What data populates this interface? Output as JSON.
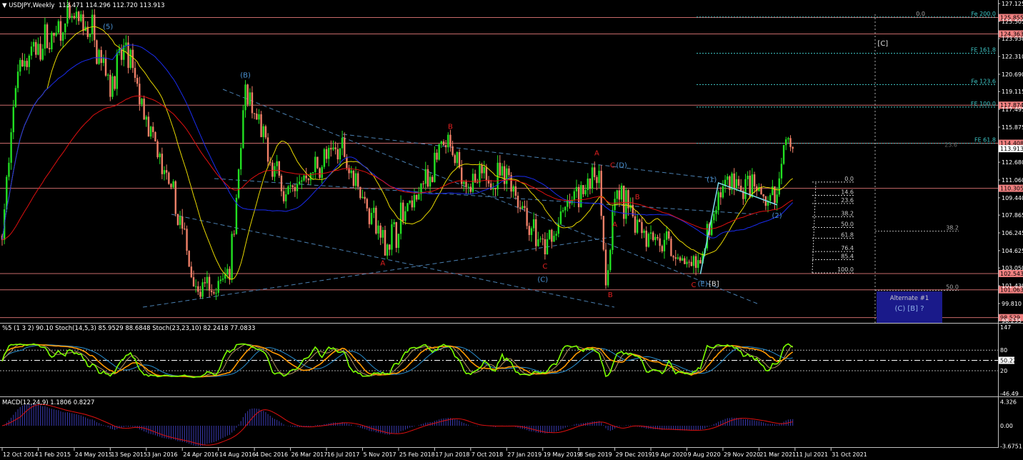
{
  "header": {
    "symbol_label": "USDJPY,Weekly",
    "ohlc": "113.471 114.296 112.720 113.913"
  },
  "stoch_panel": {
    "label": "%5 (1 3 2) 90.10  Stoch(14,5,3) 85.9529 88.6848  Stoch(23,23,10) 82.2418 77.0833",
    "axis": [
      "147",
      "80",
      "50.22",
      "20",
      "-46.49"
    ],
    "current_value": "50.22"
  },
  "macd_panel": {
    "label": "MACD(12,24,9) 1.1806 0.8227",
    "axis": [
      "4.326",
      "0.00",
      "-3.6751"
    ]
  },
  "colors": {
    "bull": "#22e022",
    "bear": "#f08068",
    "hline": "#c86a6a",
    "fib": "#3fc8c8",
    "wave_blue": "#4a90d0",
    "wave_red": "#e02020",
    "ma_fast": "#e8d800",
    "ma_mid": "#1a2cf0",
    "ma_slow": "#e01010",
    "stoch_main": "#7cff00",
    "stoch_signal": "#ff9900",
    "alt_box": "#1a1a8a"
  },
  "chart_data": {
    "type": "candlestick",
    "title": "USDJPY,Weekly",
    "price_axis": [
      "127.125",
      "125.505",
      "123.930",
      "122.310",
      "120.690",
      "119.115",
      "117.495",
      "115.875",
      "112.680",
      "111.060",
      "109.440",
      "107.865",
      "106.245",
      "104.625",
      "103.050",
      "101.430",
      "99.810",
      "98.235"
    ],
    "ylim": [
      98.235,
      127.125
    ],
    "date_ticks": [
      "12 Oct 2014",
      "1 Feb 2015",
      "24 May 2015",
      "13 Sep 2015",
      "3 Jan 2016",
      "24 Apr 2016",
      "14 Aug 2016",
      "4 Dec 2016",
      "26 Mar 2017",
      "16 Jul 2017",
      "5 Nov 2017",
      "25 Feb 2018",
      "17 Jun 2018",
      "7 Oct 2018",
      "27 Jan 2019",
      "19 May 2019",
      "8 Sep 2019",
      "29 Dec 2019",
      "19 Apr 2020",
      "9 Aug 2020",
      "29 Nov 2020",
      "21 Mar 2021",
      "11 Jul 2021",
      "31 Oct 2021"
    ],
    "weeks_per_tick": 16,
    "close_path": [
      [
        0,
        106
      ],
      [
        7,
        121.6
      ],
      [
        31,
        125.5
      ],
      [
        40,
        124.5
      ],
      [
        48,
        120
      ],
      [
        55,
        123
      ],
      [
        66,
        115
      ],
      [
        78,
        108
      ],
      [
        86,
        101.4
      ],
      [
        94,
        100.5
      ],
      [
        101,
        103.4
      ],
      [
        108,
        118.7
      ],
      [
        120,
        112.5
      ],
      [
        126,
        109.9
      ],
      [
        151,
        114.1
      ],
      [
        170,
        105
      ],
      [
        197,
        114.1
      ],
      [
        208,
        110.5
      ],
      [
        224,
        111.8
      ],
      [
        240,
        104.4
      ],
      [
        253,
        109.3
      ],
      [
        265,
        111.9
      ],
      [
        268,
        101.4
      ],
      [
        272,
        109.6
      ],
      [
        281,
        107.7
      ],
      [
        308,
        102.5
      ],
      [
        321,
        110.9
      ],
      [
        343,
        109
      ],
      [
        348,
        114.3
      ],
      [
        351,
        113.913
      ]
    ],
    "last_price": "113.913",
    "horizontal_levels": [
      "125.855",
      "124.363",
      "117.874",
      "114.408",
      "110.305",
      "102.543",
      "101.063",
      "98.529"
    ],
    "fib_extensions": [
      {
        "label": "Fe 200.0",
        "price": 125.9
      },
      {
        "label": "FE 161.8",
        "price": 122.6
      },
      {
        "label": "Fe 123.6",
        "price": 119.75
      },
      {
        "label": "FE 100.0",
        "price": 117.7
      },
      {
        "label": "FE 61.8",
        "price": 114.4
      }
    ],
    "fib_top_zero": {
      "label": "0.0",
      "price": 125.9
    },
    "fib_236_label": {
      "label": "23.6",
      "price": 114.2
    },
    "retracement": {
      "top": 110.87,
      "bottom": 102.6,
      "levels": [
        "0.0",
        "14.6",
        "23.6",
        "38.2",
        "50.0",
        "61.8",
        "76.4",
        "85.4",
        "100.0"
      ]
    },
    "side_levels": [
      {
        "label": "38.2",
        "price": 106.4
      },
      {
        "label": "50.0",
        "price": 101.0
      }
    ],
    "wave_labels": [
      {
        "text": "(5)",
        "week": 47,
        "price": 124.8,
        "color": "blue"
      },
      {
        "text": "(B)",
        "week": 108,
        "price": 120.4,
        "color": "blue"
      },
      {
        "text": "B",
        "week": 199,
        "price": 115.7,
        "color": "red"
      },
      {
        "text": "A",
        "week": 169,
        "price": 103.3,
        "color": "red"
      },
      {
        "text": "C",
        "week": 241,
        "price": 103.0,
        "color": "red"
      },
      {
        "text": "(C)",
        "week": 240,
        "price": 101.8,
        "color": "blue"
      },
      {
        "text": "A",
        "week": 264,
        "price": 113.3,
        "color": "red"
      },
      {
        "text": "C",
        "week": 271,
        "price": 112.2,
        "color": "red"
      },
      {
        "text": "(D)",
        "week": 275,
        "price": 112.2,
        "color": "blue"
      },
      {
        "text": "B",
        "week": 270,
        "price": 100.4,
        "color": "red"
      },
      {
        "text": "A",
        "week": 272,
        "price": 106.8,
        "color": "red"
      },
      {
        "text": "B",
        "week": 282,
        "price": 109.3,
        "color": "red"
      },
      {
        "text": "C",
        "week": 307,
        "price": 101.3,
        "color": "red"
      },
      {
        "text": "(E)",
        "week": 311,
        "price": 101.4,
        "color": "blue"
      },
      {
        "text": "[B]",
        "week": 316,
        "price": 101.4,
        "color": "white"
      },
      {
        "text": "(1)",
        "week": 315,
        "price": 110.9,
        "color": "blue"
      },
      {
        "text": "(2)",
        "week": 344,
        "price": 107.6,
        "color": "blue"
      },
      {
        "text": "[C]",
        "week": 391,
        "price": 123.3,
        "color": "white"
      }
    ],
    "alternate_box": {
      "title": "Alternate #1",
      "text": "(C) [B] ?"
    },
    "indicators": [
      "SMA 21",
      "SMA 50",
      "SMA 200",
      "Stoch(14,5,3)",
      "Stoch(23,23,10)",
      "MACD(12,24,9)"
    ]
  }
}
